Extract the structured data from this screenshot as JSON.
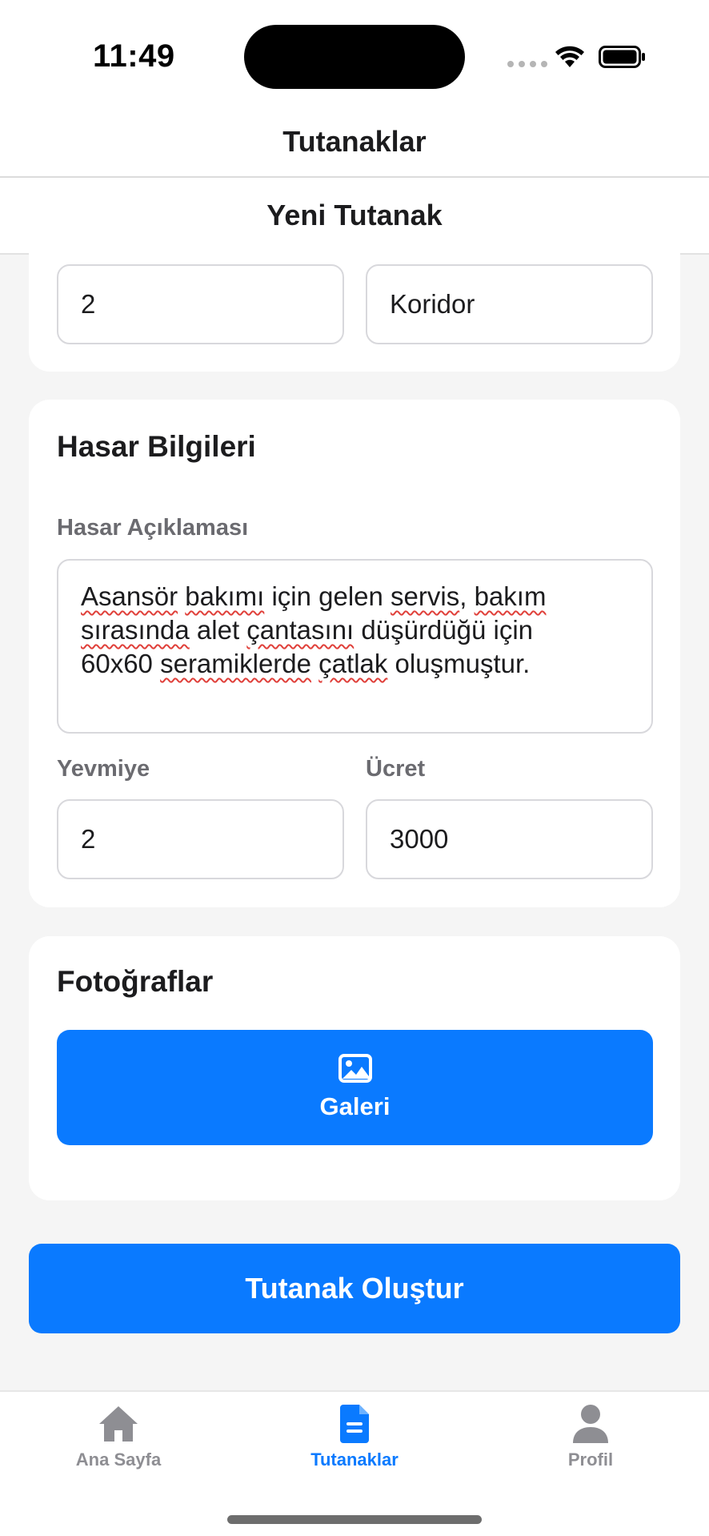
{
  "status_bar": {
    "time": "11:49"
  },
  "header": {
    "title": "Tutanaklar"
  },
  "subheader": {
    "title": "Yeni Tutanak"
  },
  "location": {
    "floor_value": "2",
    "area_value": "Koridor"
  },
  "damage": {
    "section_title": "Hasar Bilgileri",
    "description_label": "Hasar Açıklaması",
    "description_lines": [
      [
        "",
        "Asansör",
        " ",
        "bakımı",
        " için gelen ",
        "servis",
        ", ",
        "bakım",
        ""
      ],
      [
        "",
        "sırasında",
        " alet ",
        "çantasını",
        " düşürdüğü için",
        "",
        "",
        "",
        ""
      ],
      [
        "60x60 ",
        "seramiklerde",
        " ",
        "çatlak",
        " oluşmuştur.",
        "",
        "",
        "",
        ""
      ]
    ],
    "days_label": "Yevmiye",
    "days_value": "2",
    "fee_label": "Ücret",
    "fee_value": "3000"
  },
  "photos": {
    "section_title": "Fotoğraflar",
    "gallery_label": "Galeri",
    "gallery_icon": "image-icon"
  },
  "actions": {
    "submit_label": "Tutanak Oluştur"
  },
  "tab_bar": {
    "items": [
      {
        "label": "Ana Sayfa",
        "icon": "home-icon",
        "active": false
      },
      {
        "label": "Tutanaklar",
        "icon": "document-icon",
        "active": true
      },
      {
        "label": "Profil",
        "icon": "person-icon",
        "active": false
      }
    ]
  },
  "colors": {
    "accent": "#0a7aff",
    "background": "#f5f5f5",
    "card": "#ffffff",
    "inactive_tab": "#8e8e93",
    "spellcheck": "#e0403a"
  }
}
